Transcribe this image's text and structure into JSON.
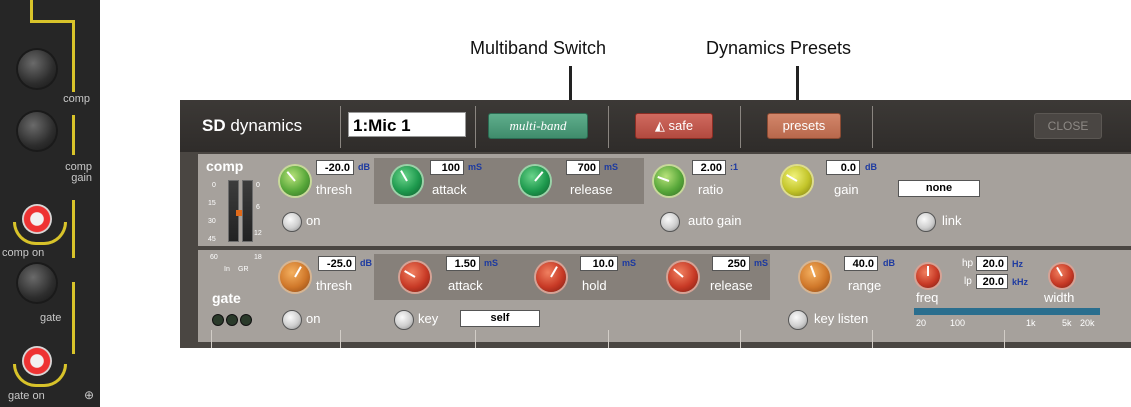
{
  "callouts": {
    "multiband_switch": "Multiband Switch",
    "dynamics_presets": "Dynamics Presets"
  },
  "strip": {
    "comp": "comp",
    "comp_gain_1": "comp",
    "comp_gain_2": "gain",
    "comp_on": "comp on",
    "gate": "gate",
    "gate_on": "gate on"
  },
  "title": {
    "sd": "SD",
    "dynamics": "dynamics",
    "channel": "1:Mic 1",
    "multiband": "multi-band",
    "safe": "safe",
    "presets": "presets",
    "close": "CLOSE"
  },
  "comp": {
    "label": "comp",
    "thresh_value": "-20.0",
    "thresh_unit": "dB",
    "thresh_label": "thresh",
    "attack_value": "100",
    "attack_unit": "mS",
    "attack_label": "attack",
    "release_value": "700",
    "release_unit": "mS",
    "release_label": "release",
    "ratio_value": "2.00",
    "ratio_unit": ":1",
    "ratio_label": "ratio",
    "gain_value": "0.0",
    "gain_unit": "dB",
    "gain_label": "gain",
    "none_box": "none",
    "on_label": "on",
    "auto_gain_label": "auto gain",
    "link_label": "link"
  },
  "meter": {
    "in_label": "In",
    "gr_label": "GR",
    "left_scale": [
      "0",
      "15",
      "30",
      "45",
      "60"
    ],
    "right_scale": [
      "0",
      "6",
      "12",
      "18"
    ]
  },
  "gate": {
    "label": "gate",
    "thresh_value": "-25.0",
    "thresh_unit": "dB",
    "thresh_label": "thresh",
    "attack_value": "1.50",
    "attack_unit": "mS",
    "attack_label": "attack",
    "hold_value": "10.0",
    "hold_unit": "mS",
    "hold_label": "hold",
    "release_value": "250",
    "release_unit": "mS",
    "release_label": "release",
    "range_value": "40.0",
    "range_unit": "dB",
    "range_label": "range",
    "on_label": "on",
    "key_label": "key",
    "key_value": "self",
    "key_listen_label": "key listen",
    "freq_label": "freq",
    "hp_label": "hp",
    "hp_value": "20.0",
    "hp_unit": "Hz",
    "lp_label": "lp",
    "lp_value": "20.0",
    "lp_unit": "kHz",
    "width_label": "width",
    "freq_scale": [
      "20",
      "100",
      "1k",
      "5k",
      "20k"
    ]
  },
  "colors": {
    "panel": "#4a4642",
    "row": "#a6a19c",
    "multiband_button": "#4f9e7c",
    "safe_button": "#c25a4f",
    "presets_button": "#c8785c",
    "strip_accent": "#d8c32a"
  }
}
